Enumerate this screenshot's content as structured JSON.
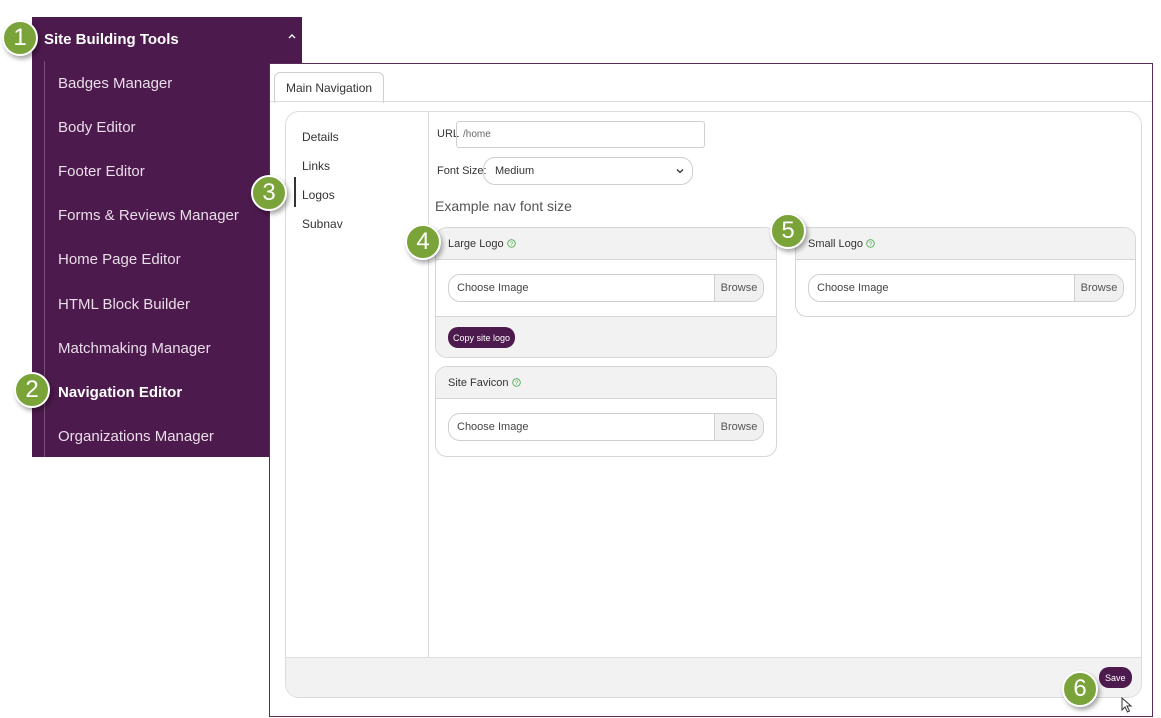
{
  "sidebar": {
    "header": "Site Building Tools",
    "items": [
      {
        "label": "Badges Manager"
      },
      {
        "label": "Body Editor"
      },
      {
        "label": "Footer Editor"
      },
      {
        "label": "Forms & Reviews Manager"
      },
      {
        "label": "Home Page Editor"
      },
      {
        "label": "HTML Block Builder"
      },
      {
        "label": "Matchmaking Manager"
      },
      {
        "label": "Navigation Editor"
      },
      {
        "label": "Organizations Manager"
      }
    ]
  },
  "main": {
    "tab": "Main Navigation",
    "nav": [
      "Details",
      "Links",
      "Logos",
      "Subnav"
    ],
    "url_label": "URL",
    "url_value": "/home",
    "font_size_label": "Font Size:",
    "font_size_value": "Medium",
    "example_text": "Example nav font size",
    "large_logo": {
      "title": "Large Logo",
      "placeholder": "Choose Image",
      "browse": "Browse",
      "copy_button": "Copy site logo"
    },
    "small_logo": {
      "title": "Small Logo",
      "placeholder": "Choose Image",
      "browse": "Browse"
    },
    "favicon": {
      "title": "Site Favicon",
      "placeholder": "Choose Image",
      "browse": "Browse"
    },
    "save": "Save"
  },
  "callouts": [
    "1",
    "2",
    "3",
    "4",
    "5",
    "6"
  ],
  "colors": {
    "brand_purple": "#4d1a4d",
    "callout_green": "#7aa33a",
    "help_green": "#4caf50"
  }
}
